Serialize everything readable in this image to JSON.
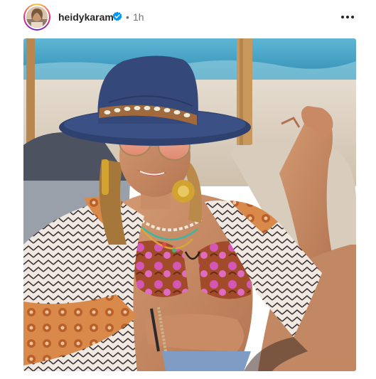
{
  "post": {
    "username": "heidykaram",
    "time_separator": "•",
    "time_ago": "1h",
    "verified_icon": "verified-badge-icon",
    "more_icon": "more-options-icon"
  },
  "colors": {
    "verified": "#0095f6",
    "text_primary": "#262626",
    "text_secondary": "#737373",
    "hat": "#34487a",
    "sea": "#3e9cc0"
  }
}
